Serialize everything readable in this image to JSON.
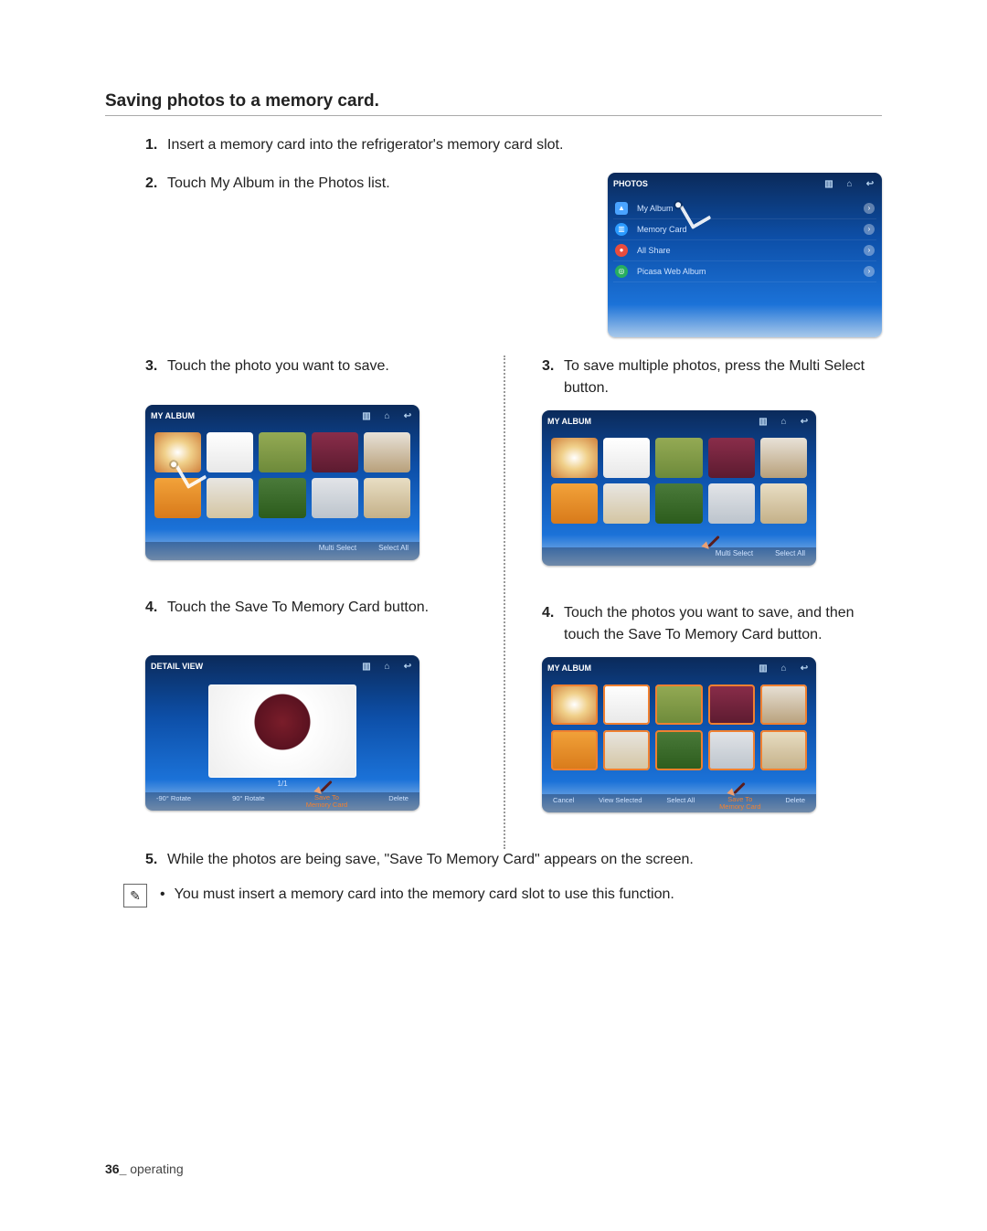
{
  "section_title": "Saving photos to a memory card.",
  "steps_shared": {
    "s1": {
      "num": "1.",
      "text": "Insert a memory card into the refrigerator's memory card slot."
    },
    "s2": {
      "num": "2.",
      "text": "Touch My Album in the Photos list."
    }
  },
  "col_left": {
    "s3": {
      "num": "3.",
      "text": "Touch the photo you want to save."
    },
    "s4": {
      "num": "4.",
      "text": "Touch the Save To Memory Card button."
    }
  },
  "col_right": {
    "s3": {
      "num": "3.",
      "text": "To save multiple photos, press the Multi Select button."
    },
    "s4": {
      "num": "4.",
      "text": "Touch the photos you want to save, and then touch the Save To Memory Card button."
    }
  },
  "step5": {
    "num": "5.",
    "text": "While the photos are being save, \"Save To Memory Card\" appears on the screen."
  },
  "note": {
    "bullet": "•",
    "text": "You must insert a memory card into the memory card slot to use this function."
  },
  "footer": {
    "page": "36_",
    "section": " operating"
  },
  "screens": {
    "photos_list": {
      "title": "PHOTOS",
      "items": [
        {
          "label": "My Album"
        },
        {
          "label": "Memory Card"
        },
        {
          "label": "All Share"
        },
        {
          "label": "Picasa Web Album"
        }
      ]
    },
    "album_grid": {
      "title": "MY ALBUM",
      "btn_multi": "Multi Select",
      "btn_selall": "Select All"
    },
    "detail_view": {
      "title": "DETAIL VIEW",
      "caption": "1/1",
      "btn_rotl": "-90°  Rotate",
      "btn_rotr": "90°  Rotate",
      "btn_save": "Save To\nMemory Card",
      "btn_delete": "Delete"
    },
    "select_view": {
      "title": "MY ALBUM",
      "btn_cancel": "Cancel",
      "btn_viewsel": "View Selected",
      "btn_selall": "Select All",
      "btn_save": "Save To\nMemory Card",
      "btn_delete": "Delete"
    }
  }
}
